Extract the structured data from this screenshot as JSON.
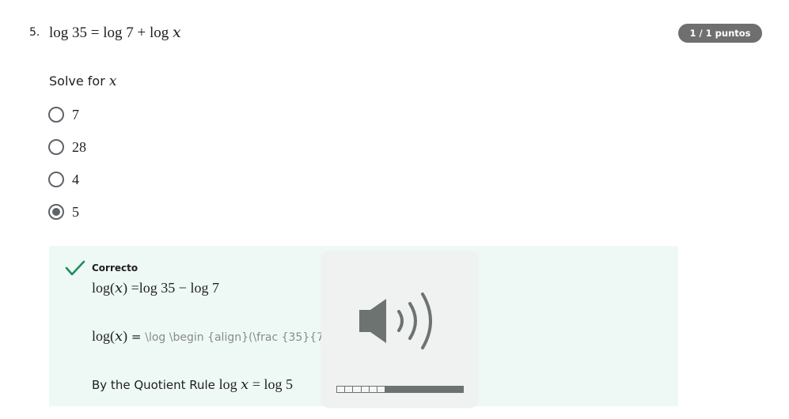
{
  "question": {
    "number": "5.",
    "title": "log 35 = log 7 + log 𝑥",
    "points_badge": "1 / 1 puntos",
    "prompt_text": "Solve for",
    "prompt_var": "𝑥"
  },
  "options": [
    {
      "label": "7",
      "selected": false
    },
    {
      "label": "28",
      "selected": false
    },
    {
      "label": "4",
      "selected": false
    },
    {
      "label": "5",
      "selected": true
    }
  ],
  "feedback": {
    "status": "Correcto",
    "line1": "log(𝑥) =log 35 − log 7",
    "line2_math": "log(𝑥)",
    "line2_eq": " = ",
    "line2_raw": "\\log \\begin {align}(\\frac {35}{7",
    "line3_text": "By the Quotient Rule ",
    "line3_math": "log 𝑥 = log 5",
    "accent_color": "#1e8e5a"
  },
  "audio_overlay": {
    "icon": "speaker-volume-icon",
    "volume_level": 0.38
  }
}
